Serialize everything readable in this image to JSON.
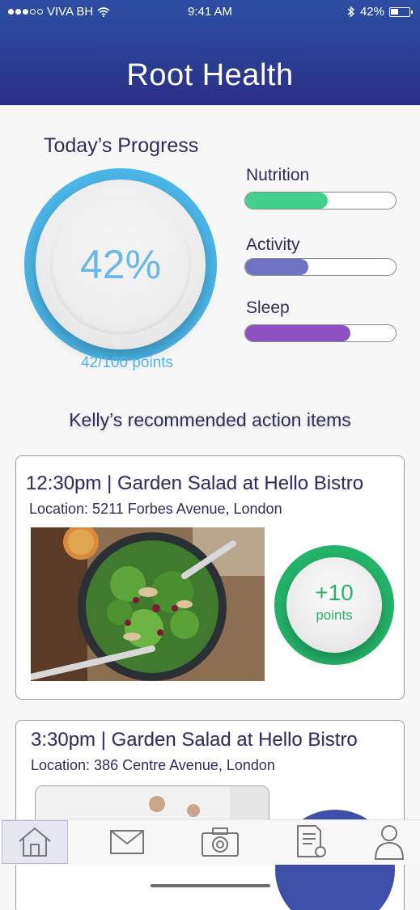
{
  "status_bar": {
    "carrier": "VIVA BH",
    "time": "9:41 AM",
    "battery": "42%",
    "battery_level": 0.42
  },
  "header": {
    "title": "Root Health"
  },
  "progress": {
    "title": "Today’s Progress",
    "percent": "42%",
    "points": "42/100 points",
    "categories": [
      {
        "label": "Nutrition",
        "level": 0.55,
        "color": "#45cf8c"
      },
      {
        "label": "Activity",
        "level": 0.42,
        "color": "#6f73c2"
      },
      {
        "label": "Sleep",
        "level": 0.7,
        "color": "#8d52c1"
      }
    ]
  },
  "recommendations": {
    "title": "Kelly’s recommended action items",
    "items": [
      {
        "time_title": "12:30pm | Garden Salad at Hello Bistro",
        "location": "Location: 5211 Forbes Avenue, London",
        "points": "+10",
        "points_unit": "points",
        "badge_color": "#24b469"
      },
      {
        "time_title": "3:30pm | Garden Salad at Hello Bistro",
        "location": "Location: 386 Centre Avenue, London",
        "badge_color": "#3d4fa8"
      }
    ]
  },
  "tabbar": {
    "tabs": [
      {
        "icon": "home-icon",
        "active": true
      },
      {
        "icon": "mail-icon",
        "active": false
      },
      {
        "icon": "camera-icon",
        "active": false
      },
      {
        "icon": "document-icon",
        "active": false
      },
      {
        "icon": "profile-icon",
        "active": false
      }
    ]
  },
  "colors": {
    "header": "#2b3f93",
    "ring": "#4bb6e8",
    "text_dark": "#2f2d5a",
    "points_blue": "#52b6e8"
  }
}
